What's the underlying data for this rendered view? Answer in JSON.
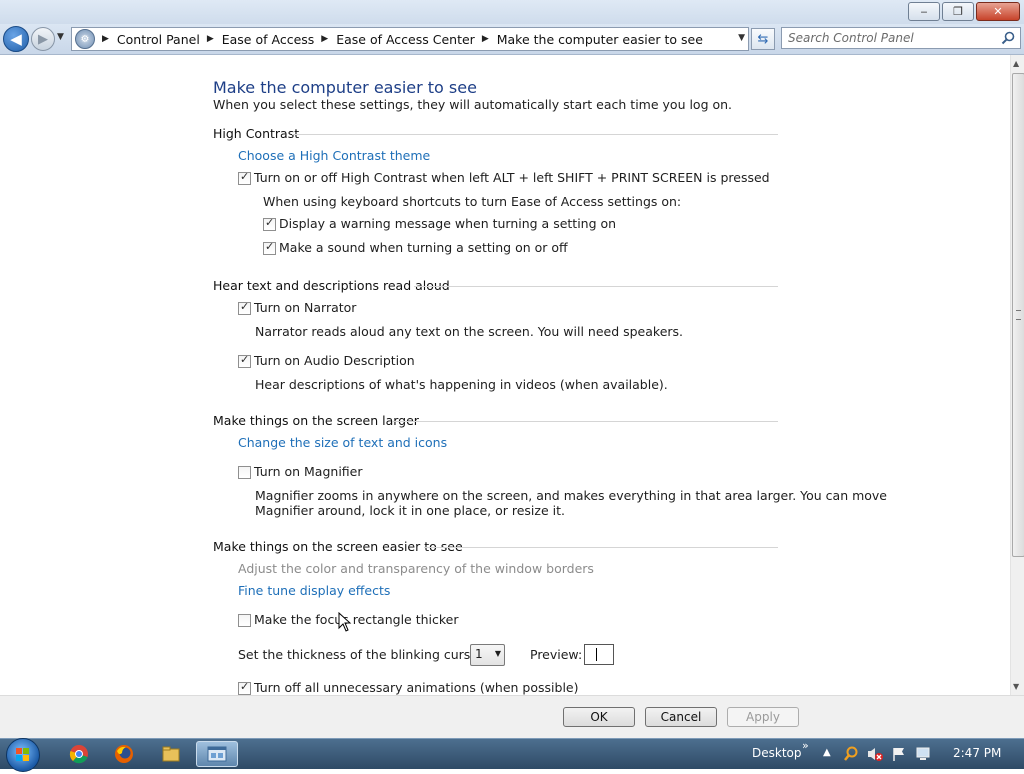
{
  "window": {
    "minimize_glyph": "‒",
    "maximize_glyph": "❐",
    "close_glyph": "✕"
  },
  "address": {
    "breadcrumbs": [
      "Control Panel",
      "Ease of Access",
      "Ease of Access Center",
      "Make the computer easier to see"
    ],
    "search_placeholder": "Search Control Panel"
  },
  "page": {
    "title": "Make the computer easier to see",
    "subtitle": "When you select these settings, they will automatically start each time you log on."
  },
  "high_contrast": {
    "heading": "High Contrast",
    "theme_link": "Choose a High Contrast theme",
    "toggle_label": "Turn on or off High Contrast when left ALT + left SHIFT + PRINT SCREEN is pressed",
    "toggle_checked": true,
    "shortcut_note": "When using keyboard shortcuts to turn Ease of Access settings on:",
    "warning_label": "Display a warning message when turning a setting on",
    "warning_checked": true,
    "sound_label": "Make a sound when turning a setting on or off",
    "sound_checked": true
  },
  "narration": {
    "heading": "Hear text and descriptions read aloud",
    "narrator_label": "Turn on Narrator",
    "narrator_checked": true,
    "narrator_desc": "Narrator reads aloud any text on the screen. You will need speakers.",
    "audio_label": "Turn on Audio Description",
    "audio_checked": true,
    "audio_desc": "Hear descriptions of what's happening in videos (when available)."
  },
  "larger": {
    "heading": "Make things on the screen larger",
    "size_link": "Change the size of text and icons",
    "magnifier_label": "Turn on Magnifier",
    "magnifier_checked": false,
    "magnifier_desc_1": "Magnifier zooms in anywhere on the screen, and makes everything in that area larger. You can move",
    "magnifier_desc_2": "Magnifier around, lock it in one place, or resize it."
  },
  "easier": {
    "heading": "Make things on the screen easier to see",
    "color_link": "Adjust the color and transparency of the window borders",
    "finetune_link": "Fine tune display effects",
    "focus_label": "Make the focus rectangle thicker",
    "focus_checked": false,
    "cursor_label": "Set the thickness of the blinking cursor:",
    "cursor_value": "1",
    "preview_label": "Preview:",
    "animations_label": "Turn off all unnecessary animations (when possible)",
    "animations_checked": true
  },
  "buttons": {
    "ok": "OK",
    "cancel": "Cancel",
    "apply": "Apply"
  },
  "taskbar": {
    "desktop_label": "Desktop",
    "chevron": "»",
    "clock": "2:47 PM"
  }
}
